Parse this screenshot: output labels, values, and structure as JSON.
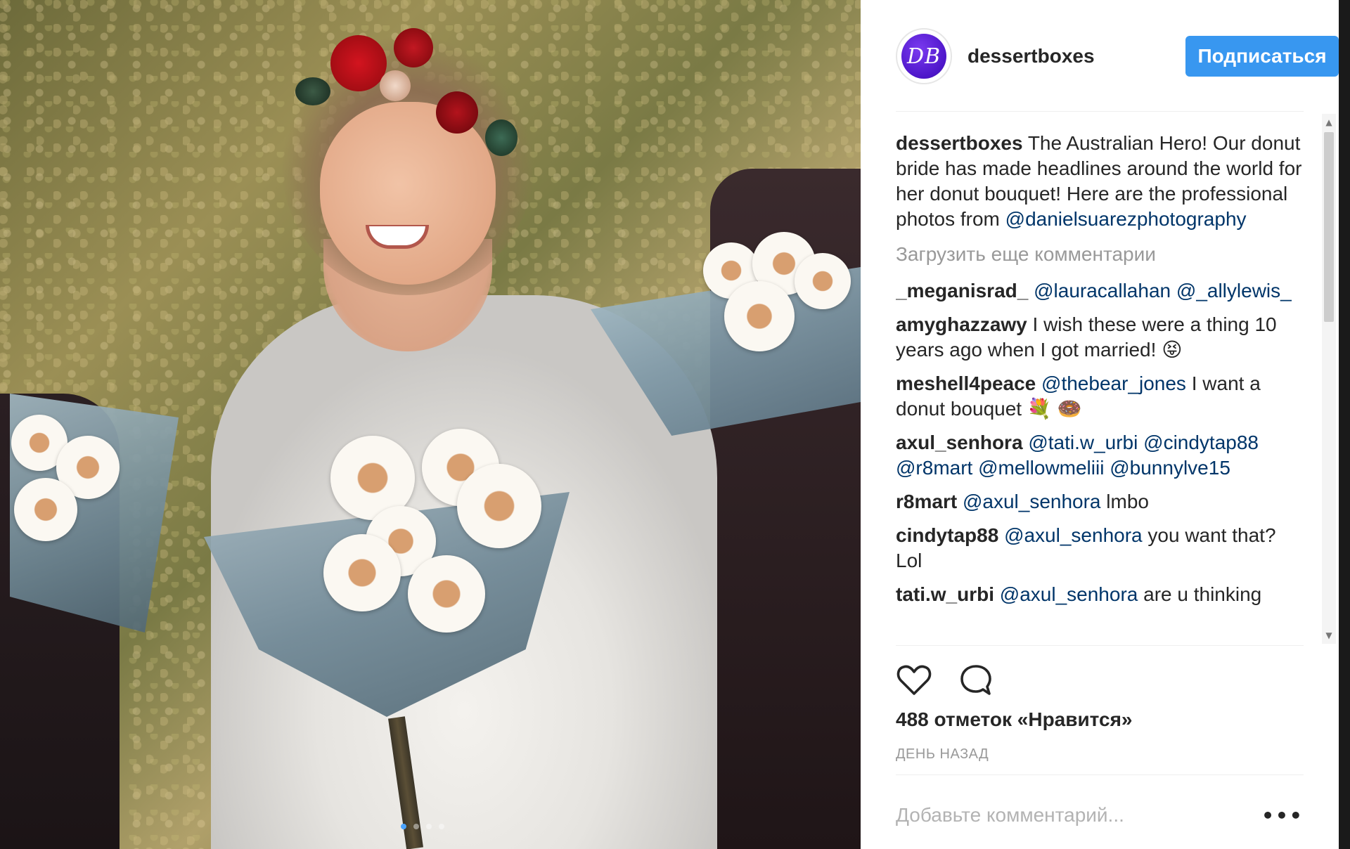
{
  "post": {
    "username": "dessertboxes",
    "avatar_initials": "DB",
    "follow_label": "Подписаться",
    "caption": {
      "user": "dessertboxes",
      "text": " The Australian Hero! Our donut bride has made headlines around the world for her donut bouquet! Here are the professional photos from ",
      "mention": "@danielsuarezphotography"
    },
    "load_more_label": "Загрузить еще комментарии",
    "comments": [
      {
        "user": "_meganisrad_",
        "segments": [
          {
            "t": " "
          },
          {
            "m": "@lauracallahan"
          },
          {
            "t": " "
          },
          {
            "m": "@_allylewis_"
          }
        ]
      },
      {
        "user": "amyghazzawy",
        "segments": [
          {
            "t": " I wish these were a thing 10 years ago when I got married! 😝"
          }
        ]
      },
      {
        "user": "meshell4peace",
        "segments": [
          {
            "t": " "
          },
          {
            "m": "@thebear_jones"
          },
          {
            "t": " I want a donut bouquet 💐 🍩"
          }
        ]
      },
      {
        "user": "axul_senhora",
        "segments": [
          {
            "t": " "
          },
          {
            "m": "@tati.w_urbi"
          },
          {
            "t": " "
          },
          {
            "m": "@cindytap88"
          },
          {
            "t": " "
          },
          {
            "m": "@r8mart"
          },
          {
            "t": " "
          },
          {
            "m": "@mellowmeliii"
          },
          {
            "t": " "
          },
          {
            "m": "@bunnylve15"
          }
        ]
      },
      {
        "user": "r8mart",
        "segments": [
          {
            "t": " "
          },
          {
            "m": "@axul_senhora"
          },
          {
            "t": " lmbo"
          }
        ]
      },
      {
        "user": "cindytap88",
        "segments": [
          {
            "t": " "
          },
          {
            "m": "@axul_senhora"
          },
          {
            "t": " you want that? Lol"
          }
        ]
      },
      {
        "user": "tati.w_urbi",
        "segments": [
          {
            "t": " "
          },
          {
            "m": "@axul_senhora"
          },
          {
            "t": " are u thinking"
          }
        ]
      }
    ],
    "likes_label": "488 отметок «Нравится»",
    "time_label": "ДЕНЬ НАЗАД",
    "comment_placeholder": "Добавьте комментарий...",
    "more_label": "•••",
    "icons": {
      "like": "heart-icon",
      "comment": "speech-bubble-icon"
    }
  },
  "colors": {
    "follow_button": "#3897f0",
    "mention": "#003569",
    "avatar": "#4d16c9",
    "muted_text": "#999999"
  },
  "carousel": {
    "total": 4,
    "active": 1
  }
}
